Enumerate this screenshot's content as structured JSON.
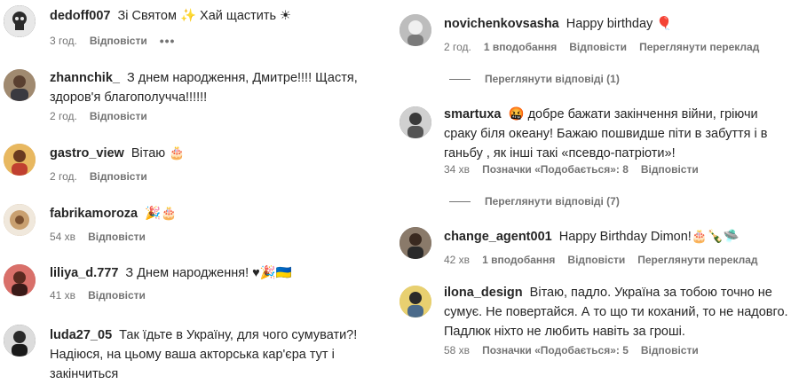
{
  "colors": {
    "text": "#262626",
    "meta": "#737373"
  },
  "left_comments": [
    {
      "username": "dedoff007",
      "text": "Зі Святом ✨ Хай щастить ☀",
      "time": "3 год.",
      "reply": "Відповісти",
      "more": "•••",
      "avatar_icon": "skull-portrait",
      "avatar_color": "#5a5a5a"
    },
    {
      "username": "zhannchik_",
      "text": "З днем народження, Дмитре!!!! Щастя, здоров'я благополучча!!!!!!",
      "time": "2 год.",
      "reply": "Відповісти",
      "avatar_icon": "person-photo",
      "avatar_color": "#8a7058"
    },
    {
      "username": "gastro_view",
      "text": "Вітаю 🎂",
      "time": "2 год.",
      "reply": "Відповісти",
      "avatar_icon": "person-photo",
      "avatar_color": "#d49a3a"
    },
    {
      "username": "fabrikamoroza",
      "text": "🎉🎂",
      "time": "54 хв",
      "reply": "Відповісти",
      "avatar_icon": "logo",
      "avatar_color": "#b58a5a"
    },
    {
      "username": "liliya_d.777",
      "text": "З Днем народження! ♥🎉🇺🇦",
      "time": "41 хв",
      "reply": "Відповісти",
      "avatar_icon": "person-photo",
      "avatar_color": "#b5413a"
    },
    {
      "username": "luda27_05",
      "text": "Так їдьте в Україну, для чого сумувати?! Надіюся, на цьому ваша акторська кар'єра тут і закінчиться",
      "time": "",
      "reply": "",
      "avatar_icon": "person-photo",
      "avatar_color": "#3a3a3a"
    }
  ],
  "right_comments": [
    {
      "username": "novichenkovsasha",
      "text": "Happy birthday 🎈",
      "time": "2 год.",
      "likes": "1 вподобання",
      "reply": "Відповісти",
      "translate": "Переглянути переклад",
      "avatar_icon": "person-photo",
      "avatar_color": "#9a9a9a"
    },
    {
      "username": "smartuxa",
      "text": "🤬 добре бажати закінчення війни, гріючи сраку біля океану! Бажаю пошвидше піти в забуття і в ганьбу , як інші такі «псевдо-патріоти»!",
      "time": "34 хв",
      "likes": "Позначки «Подобається»: 8",
      "reply": "Відповісти",
      "avatar_icon": "person-photo",
      "avatar_color": "#6a6a6a"
    },
    {
      "username": "change_agent001",
      "text": "Happy Birthday Dimon!🎂🍾🛸",
      "time": "42 хв",
      "likes": "1 вподобання",
      "reply": "Відповісти",
      "translate": "Переглянути переклад",
      "avatar_icon": "person-photo",
      "avatar_color": "#4a4440"
    },
    {
      "username": "ilona_design",
      "text": "Вітаю, падло. Україна за тобою точно не сумує. Не повертайся. А то що ти коханий, то не надовго. Падлюк ніхто не любить навіть за гроші.",
      "time": "58 хв",
      "likes": "Позначки «Подобається»: 5",
      "reply": "Відповісти",
      "avatar_icon": "person-photo",
      "avatar_color": "#c9b04a"
    }
  ],
  "view_replies": [
    {
      "label": "Переглянути відповіді (1)"
    },
    {
      "label": "Переглянути відповіді (7)"
    }
  ]
}
